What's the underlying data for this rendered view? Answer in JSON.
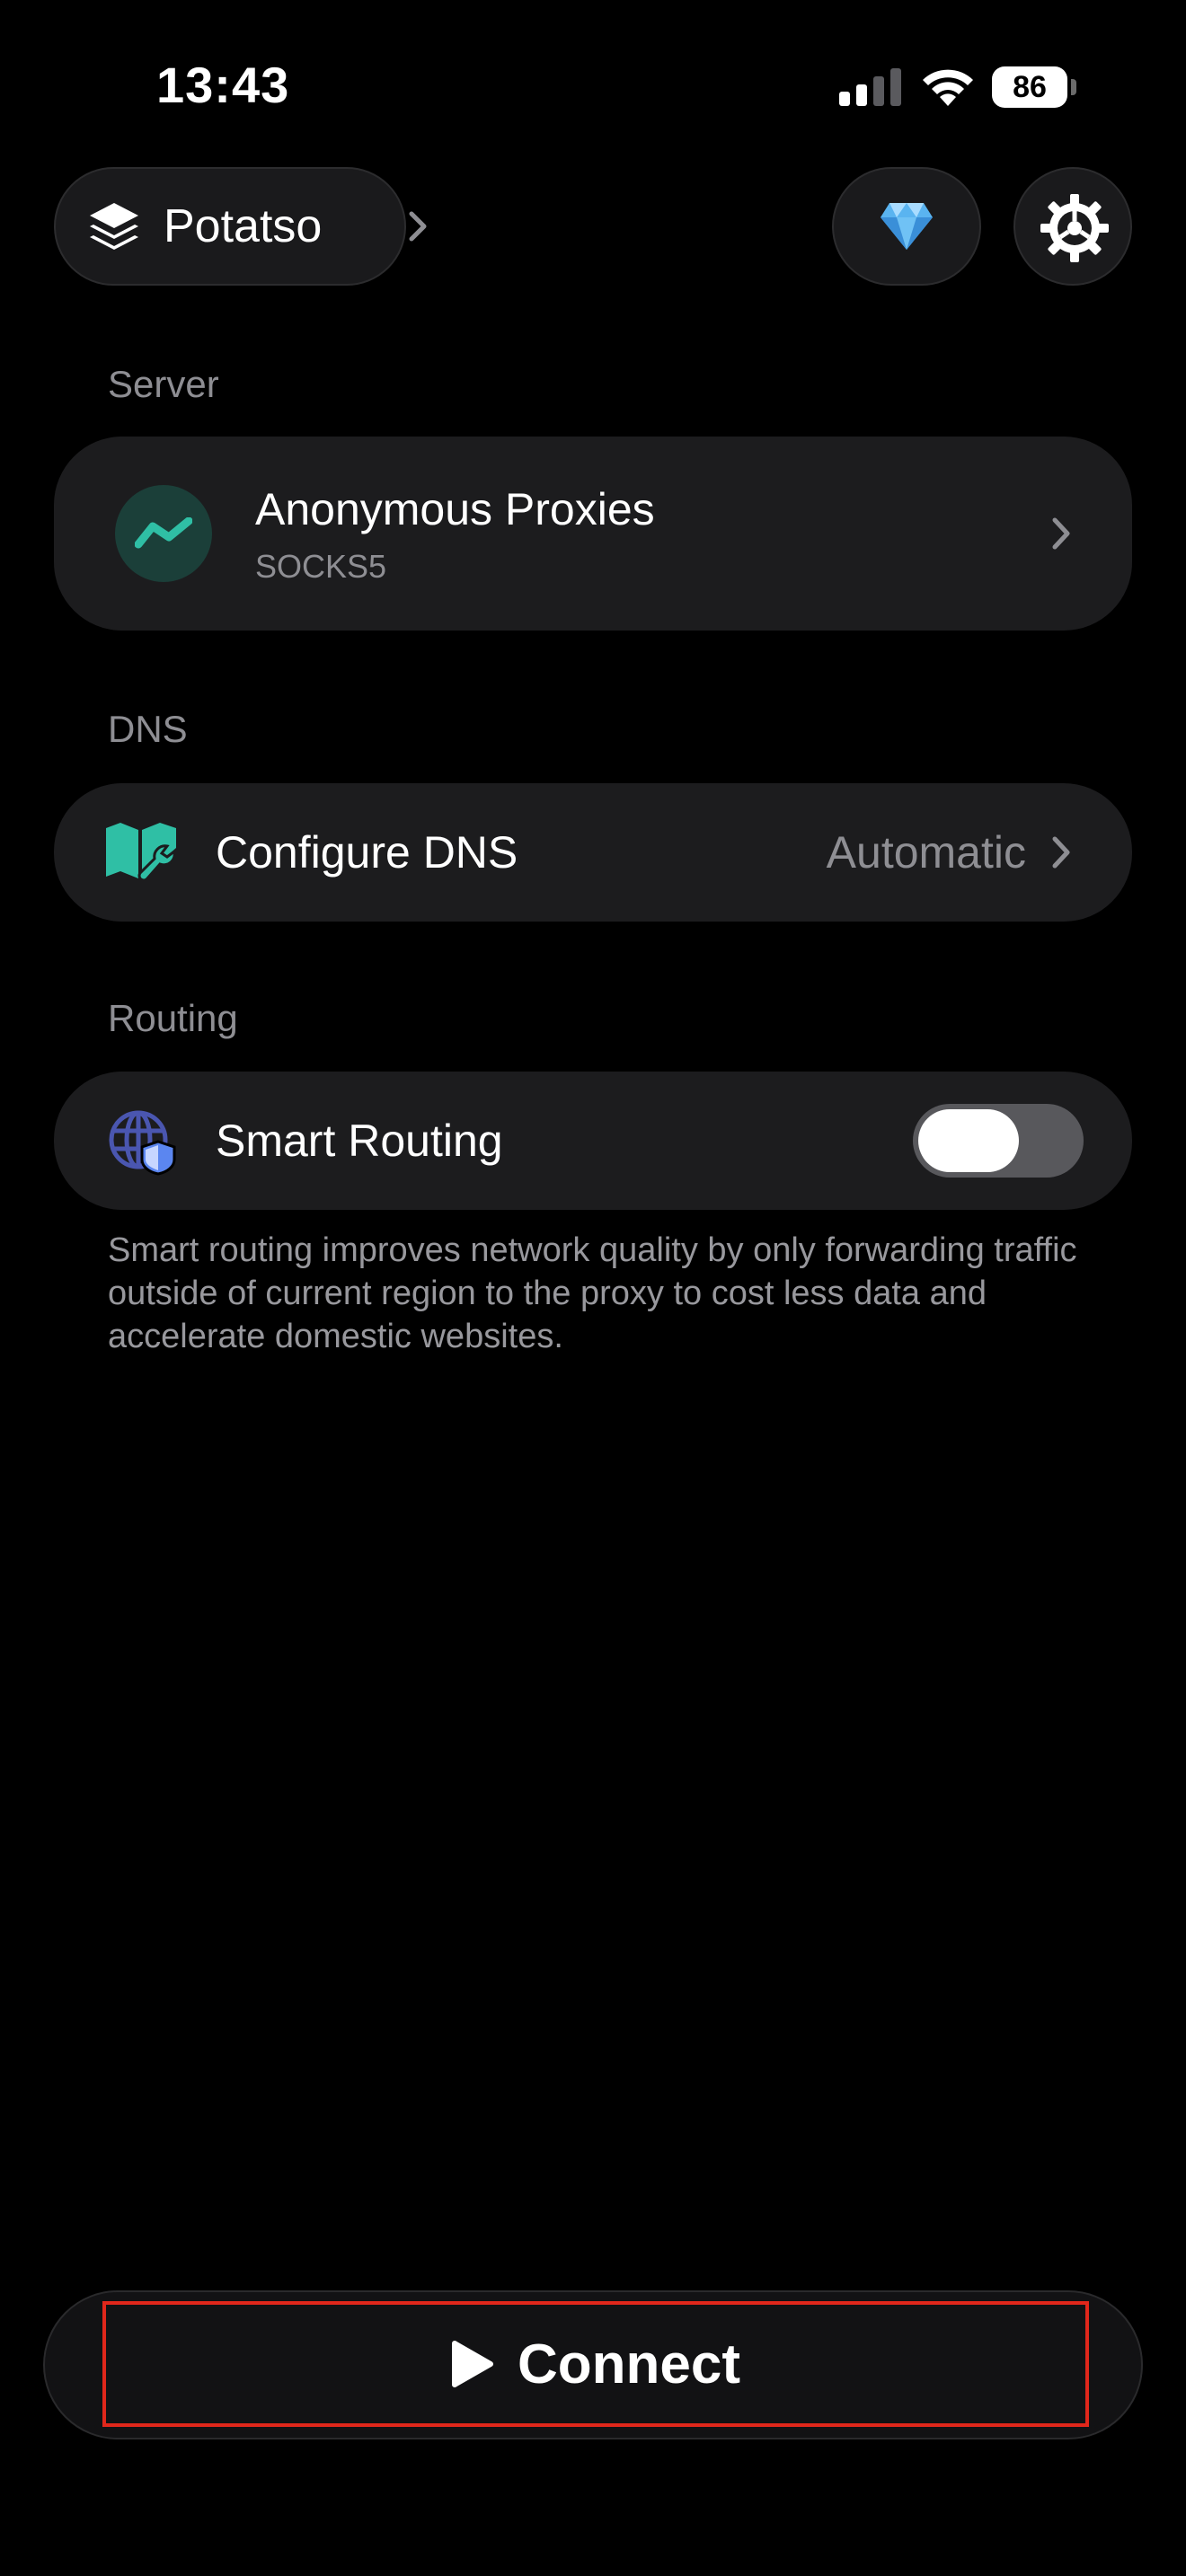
{
  "status_bar": {
    "time": "13:43",
    "battery": "86"
  },
  "top_bar": {
    "profile_label": "Potatso",
    "premium_icon": "diamond-icon",
    "settings_icon": "gear-icon"
  },
  "server_section": {
    "header": "Server",
    "name": "Anonymous Proxies",
    "type": "SOCKS5"
  },
  "dns_section": {
    "header": "DNS",
    "label": "Configure DNS",
    "value": "Automatic"
  },
  "routing_section": {
    "header": "Routing",
    "label": "Smart Routing",
    "toggle_on": false,
    "description": "Smart routing improves network quality by only forwarding traffic outside of current region to the proxy to cost less data and accelerate domestic websites."
  },
  "connect": {
    "label": "Connect"
  },
  "colors": {
    "accent_teal": "#2fbfa5",
    "highlight_red": "#e0271b",
    "card_bg": "#1c1c1e",
    "secondary_text": "#8e8e93"
  }
}
